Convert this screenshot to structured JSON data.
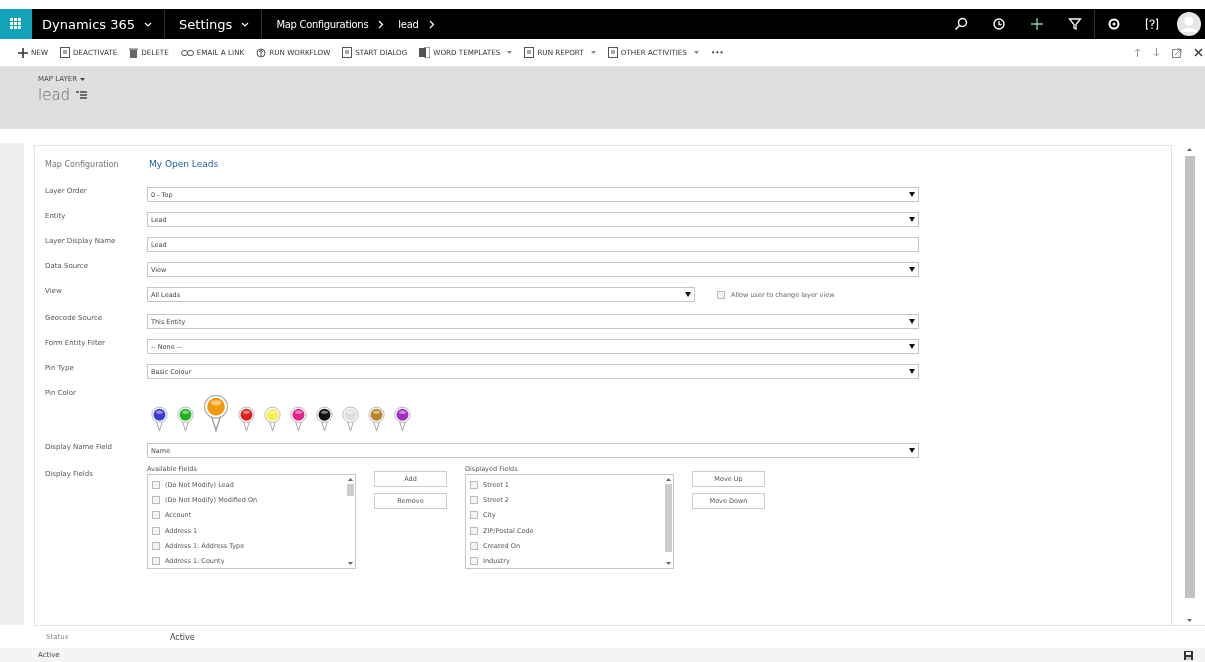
{
  "nav": {
    "app": "Dynamics 365",
    "area": "Settings",
    "breadcrumb": [
      "Map Configurations",
      "lead"
    ]
  },
  "commands": [
    {
      "label": "NEW",
      "dropdown": false
    },
    {
      "label": "DEACTIVATE",
      "dropdown": false
    },
    {
      "label": "DELETE",
      "dropdown": false
    },
    {
      "label": "EMAIL A LINK",
      "dropdown": false
    },
    {
      "label": "RUN WORKFLOW",
      "dropdown": false
    },
    {
      "label": "START DIALOG",
      "dropdown": false
    },
    {
      "label": "WORD TEMPLATES",
      "dropdown": true
    },
    {
      "label": "RUN REPORT",
      "dropdown": true
    },
    {
      "label": "OTHER ACTIVITIES",
      "dropdown": true
    },
    {
      "label": "•••",
      "dropdown": false
    }
  ],
  "header": {
    "form_selector": "MAP LAYER",
    "record": "lead"
  },
  "tab": {
    "label": "Map Configuration",
    "title": "My Open Leads"
  },
  "fields": [
    {
      "label": "Layer Order",
      "value": "0 - Top",
      "kind": "select"
    },
    {
      "label": "Entity",
      "value": "Lead",
      "kind": "select"
    },
    {
      "label": "Layer Display Name",
      "value": "Lead",
      "kind": "text"
    },
    {
      "label": "Data Source",
      "value": "View",
      "kind": "select"
    },
    {
      "label": "View",
      "value": "All Leads",
      "kind": "select-check",
      "check_label": "Allow user to change layer view",
      "checked": false
    },
    {
      "label": "Geocode Source",
      "value": "This Entity",
      "kind": "select"
    },
    {
      "label": "Form Entity Filter",
      "value": "-- None --",
      "kind": "select"
    },
    {
      "label": "Pin Type",
      "value": "Basic Colour",
      "kind": "select"
    }
  ],
  "pin_color": {
    "label": "Pin Color",
    "pins": [
      {
        "color": "#3b3bd6",
        "selected": false
      },
      {
        "color": "#22b322",
        "selected": false
      },
      {
        "color": "#f09a10",
        "selected": true
      },
      {
        "color": "#e02020",
        "selected": false
      },
      {
        "color": "#f5f050",
        "selected": false
      },
      {
        "color": "#e8208a",
        "selected": false
      },
      {
        "color": "#111111",
        "selected": false
      },
      {
        "color": "#dddddd",
        "selected": false
      },
      {
        "color": "#b8862a",
        "selected": false
      },
      {
        "color": "#a030c0",
        "selected": false
      }
    ]
  },
  "display_name_field": {
    "label": "Display Name Field",
    "value": "Name"
  },
  "display_fields": {
    "label": "Display Fields",
    "available": {
      "title": "Available Fields",
      "items": [
        {
          "label": "(Do Not Modify) Lead",
          "checked": false
        },
        {
          "label": "(Do Not Modify) Modified On",
          "checked": false
        },
        {
          "label": "Account",
          "checked": false
        },
        {
          "label": "Address 1",
          "checked": false
        },
        {
          "label": "Address 1: Address Type",
          "checked": false
        },
        {
          "label": "Address 1: County",
          "checked": false
        }
      ]
    },
    "add_buttons": [
      "Add",
      "Remove"
    ],
    "displayed": {
      "title": "Displayed Fields",
      "items": [
        {
          "label": "Street 1",
          "checked": false
        },
        {
          "label": "Street 2",
          "checked": false
        },
        {
          "label": "City",
          "checked": false
        },
        {
          "label": "ZIP/Postal Code",
          "checked": false
        },
        {
          "label": "Created On",
          "checked": false
        },
        {
          "label": "Industry",
          "checked": false
        }
      ]
    },
    "move_buttons": [
      "Move Up",
      "Move Down"
    ]
  },
  "status": {
    "label": "Status",
    "value": "Active"
  },
  "status_bar": "Active"
}
